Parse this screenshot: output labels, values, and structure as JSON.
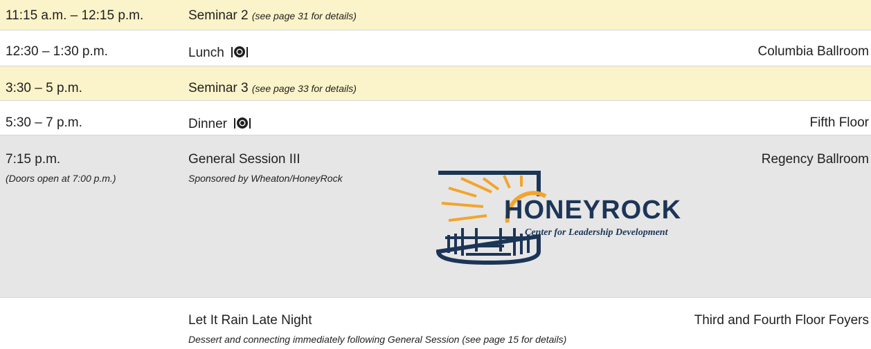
{
  "rows": [
    {
      "time": "11:15 a.m. – 12:15 p.m.",
      "title": "Seminar 2",
      "note": "(see page 31 for details)",
      "location": ""
    },
    {
      "time": "12:30 – 1:30 p.m.",
      "title": "Lunch",
      "icon": "meal-icon",
      "location": "Columbia Ballroom"
    },
    {
      "time": "3:30 – 5 p.m.",
      "title": "Seminar 3",
      "note": "(see page 33 for details)",
      "location": ""
    },
    {
      "time": "5:30 – 7 p.m.",
      "title": "Dinner",
      "icon": "meal-icon",
      "location": "Fifth Floor"
    },
    {
      "time": "7:15 p.m.",
      "time_note": "(Doors open at 7:00 p.m.)",
      "title": "General Session III",
      "sponsor": "Sponsored by Wheaton/HoneyRock",
      "location": "Regency Ballroom"
    },
    {
      "title": "Let It Rain Late Night",
      "description": "Dessert and connecting immediately following General Session (see page 15 for details)",
      "location": "Third and Fourth Floor Foyers"
    }
  ],
  "logo": {
    "name": "HONEYROCK",
    "tagline": "Center for Leadership Development"
  },
  "colors": {
    "highlight_row": "#fbf3c9",
    "session_row": "#e6e6e6",
    "logo_navy": "#1c3557",
    "logo_gold": "#f2a52b"
  }
}
